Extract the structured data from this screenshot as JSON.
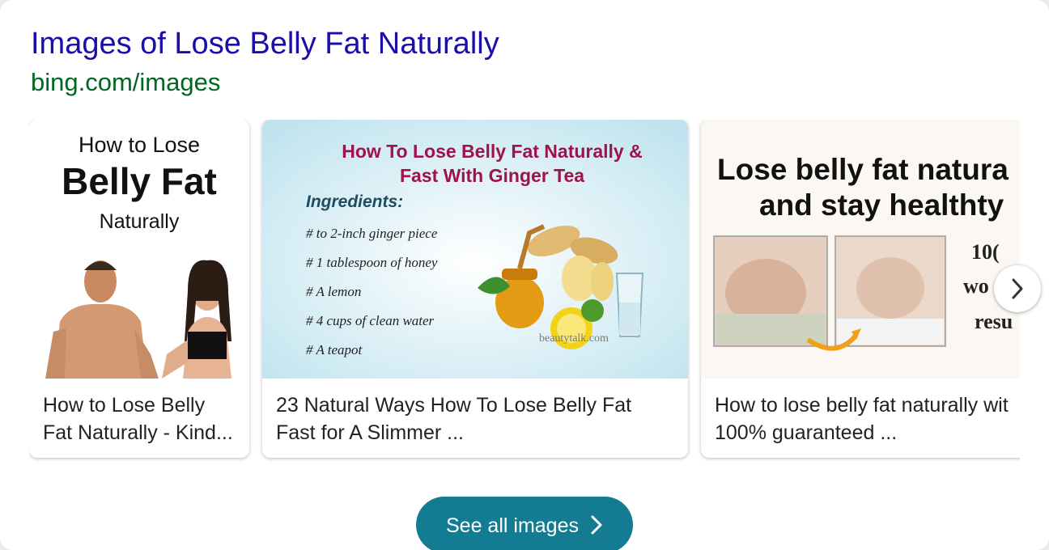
{
  "header": {
    "title": "Images of Lose Belly Fat Naturally",
    "source": "bing.com/images"
  },
  "cards": [
    {
      "caption": "How to Lose Belly\nFat Naturally - Kind...",
      "image_text": {
        "line1": "How to Lose",
        "line2": "Belly Fat",
        "line3": "Naturally"
      }
    },
    {
      "caption": "23 Natural Ways How To Lose Belly Fat\nFast for A Slimmer ...",
      "image_text": {
        "title1": "How To Lose Belly Fat Naturally &",
        "title2": "Fast With Ginger Tea",
        "ingredients_heading": "Ingredients:",
        "ingredients": [
          "# to 2-inch ginger piece",
          "# 1 tablespoon of honey",
          "# A lemon",
          "# 4 cups of clean water",
          "# A teapot"
        ],
        "watermark": "beautytalk.com"
      }
    },
    {
      "caption": "How to lose belly fat naturally wit\n100% guaranteed ...",
      "image_text": {
        "line1": "Lose belly fat natura",
        "line2": "and stay healthty",
        "side1": "10(",
        "side2": "wo",
        "side3": "resu"
      }
    }
  ],
  "carousel": {
    "next_icon": "chevron-right-icon"
  },
  "footer": {
    "see_all_label": "See all images",
    "see_all_icon": "chevron-right-icon"
  },
  "colors": {
    "title": "#1a0dab",
    "source": "#006621",
    "button": "#137c92"
  }
}
